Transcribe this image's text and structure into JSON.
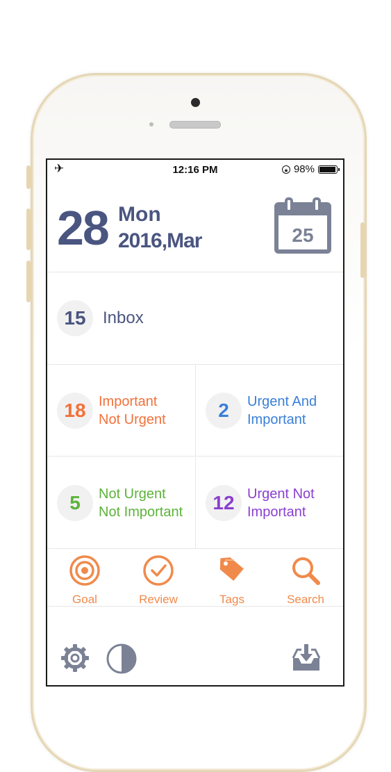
{
  "status": {
    "time": "12:16 PM",
    "battery": "98%",
    "battery_level": 0.98
  },
  "header": {
    "day": "28",
    "weekday": "Mon",
    "year_month": "2016,Mar",
    "calendar_day": "25"
  },
  "inbox": {
    "count": "15",
    "label": "Inbox"
  },
  "quadrants": [
    {
      "count": "18",
      "line1": "Important",
      "line2": "Not Urgent",
      "color": "#f2713a"
    },
    {
      "count": "2",
      "line1": "Urgent And",
      "line2": "Important",
      "color": "#3a7fd8"
    },
    {
      "count": "5",
      "line1": "Not Urgent",
      "line2": "Not Important",
      "color": "#5cb33a"
    },
    {
      "count": "12",
      "line1": "Urgent Not",
      "line2": "Important",
      "color": "#8a3fd0"
    }
  ],
  "toolbar": [
    {
      "label": "Goal",
      "icon": "target-icon"
    },
    {
      "label": "Review",
      "icon": "check-circle-icon"
    },
    {
      "label": "Tags",
      "icon": "tag-icon"
    },
    {
      "label": "Search",
      "icon": "search-icon"
    }
  ],
  "colors": {
    "primary": "#4a5580",
    "accent": "#f08a4b",
    "icon_gray": "#7b8296"
  }
}
